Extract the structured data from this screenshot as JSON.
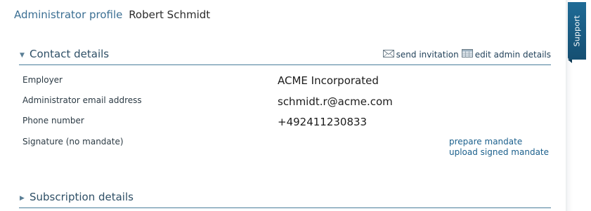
{
  "header": {
    "label": "Administrator profile",
    "name": "Robert Schmidt"
  },
  "contact": {
    "section_title": "Contact details",
    "actions": {
      "send_invitation": "send invitation",
      "edit_admin_details": "edit admin details"
    },
    "rows": [
      {
        "label": "Employer",
        "value": "ACME Incorporated"
      },
      {
        "label": "Administrator email address",
        "value": "schmidt.r@acme.com"
      },
      {
        "label": "Phone number",
        "value": "+492411230833"
      },
      {
        "label": "Signature (no mandate)",
        "value": ""
      }
    ],
    "signature_links": {
      "prepare": "prepare mandate",
      "upload": "upload signed mandate"
    }
  },
  "subscription": {
    "section_title": "Subscription details"
  },
  "support": {
    "label": "Support"
  },
  "icons": {
    "expanded_caret": "caret-down-icon",
    "collapsed_caret": "caret-right-icon",
    "send_invitation": "envelope-icon",
    "edit_admin": "table-icon"
  },
  "colors": {
    "accent": "#1f6b96",
    "link": "#1a5f8c",
    "section_line": "#4a7e9b",
    "title_label": "#3b6f93"
  }
}
